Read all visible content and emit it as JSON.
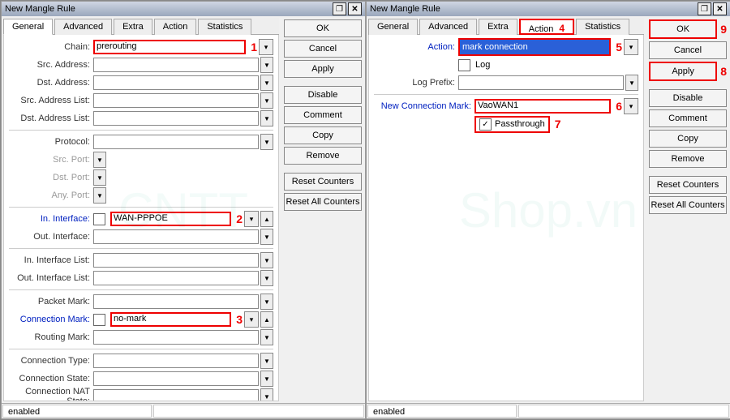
{
  "win": {
    "title": "New Mangle Rule",
    "maxIcon": "❐",
    "closeIcon": "✕"
  },
  "tabs": [
    "General",
    "Advanced",
    "Extra",
    "Action",
    "Statistics"
  ],
  "g": {
    "chain": {
      "label": "Chain:",
      "value": "prerouting"
    },
    "srcAddr": {
      "label": "Src. Address:"
    },
    "dstAddr": {
      "label": "Dst. Address:"
    },
    "srcAddrList": {
      "label": "Src. Address List:"
    },
    "dstAddrList": {
      "label": "Dst. Address List:"
    },
    "protocol": {
      "label": "Protocol:"
    },
    "srcPort": {
      "label": "Src. Port:"
    },
    "dstPort": {
      "label": "Dst. Port:"
    },
    "anyPort": {
      "label": "Any. Port:"
    },
    "inIf": {
      "label": "In. Interface:",
      "value": "WAN-PPPOE"
    },
    "outIf": {
      "label": "Out. Interface:"
    },
    "inIfList": {
      "label": "In. Interface List:"
    },
    "outIfList": {
      "label": "Out. Interface List:"
    },
    "pktMark": {
      "label": "Packet Mark:"
    },
    "conMark": {
      "label": "Connection Mark:",
      "value": "no-mark"
    },
    "rtMark": {
      "label": "Routing Mark:"
    },
    "conType": {
      "label": "Connection Type:"
    },
    "conState": {
      "label": "Connection State:"
    },
    "conNat": {
      "label": "Connection NAT State:"
    }
  },
  "a": {
    "action": {
      "label": "Action:",
      "value": "mark connection"
    },
    "log": {
      "label": "",
      "text": "Log"
    },
    "logPrefix": {
      "label": "Log Prefix:"
    },
    "newConMark": {
      "label": "New Connection Mark:",
      "value": "VaoWAN1"
    },
    "passthrough": {
      "text": "Passthrough",
      "checked": "✓"
    }
  },
  "btns": {
    "ok": "OK",
    "cancel": "Cancel",
    "apply": "Apply",
    "disable": "Disable",
    "comment": "Comment",
    "copy": "Copy",
    "remove": "Remove",
    "reset": "Reset Counters",
    "resetAll": "Reset All Counters"
  },
  "status": "enabled",
  "nums": {
    "1": "1",
    "2": "2",
    "3": "3",
    "4": "4",
    "5": "5",
    "6": "6",
    "7": "7",
    "8": "8",
    "9": "9"
  },
  "glyph": {
    "dd": "▾",
    "dn": "▼",
    "up": "▲"
  }
}
